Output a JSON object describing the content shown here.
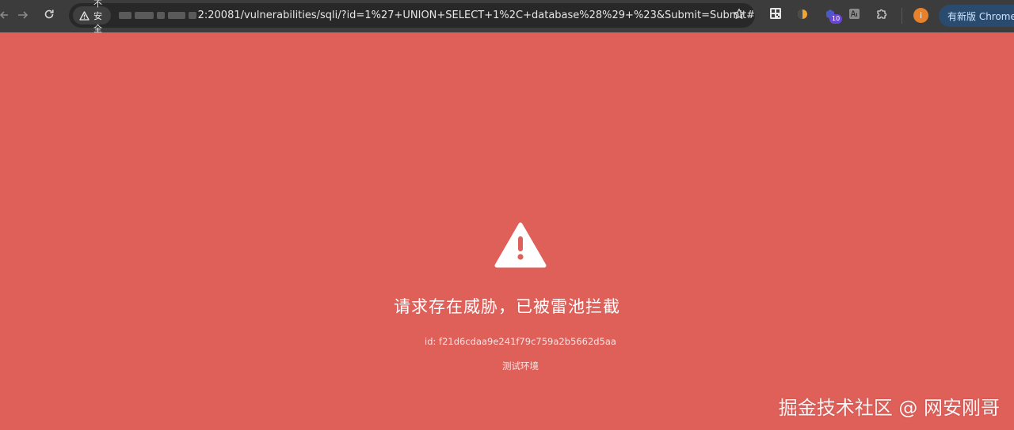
{
  "browser": {
    "back_icon": "arrow-left-icon",
    "forward_icon": "arrow-right-icon",
    "reload_icon": "reload-icon",
    "security_label": "不安全",
    "url_visible": "2:20081/vulnerabilities/sqli/?id=1%27+UNION+SELECT+1%2C+database%28%29+%23&Submit=Submit#",
    "bookmark_icon": "star-icon",
    "extensions": [
      {
        "name": "qr-code-icon"
      },
      {
        "name": "half-moon-icon"
      },
      {
        "name": "extension-badge-icon",
        "badge": "10"
      },
      {
        "name": "ai-icon"
      },
      {
        "name": "puzzle-icon"
      }
    ],
    "profile_initial": "i",
    "new_chrome_label": "有新版 Chrome"
  },
  "block": {
    "icon": "warning-triangle-icon",
    "title": "请求存在威胁，已被雷池拦截",
    "id_text": "id: f21d6cdaa9e241f79c759a2b5662d5aa",
    "env_text": "测试环境"
  },
  "watermark": "掘金技术社区 @ 网安刚哥",
  "colors": {
    "background": "#df5f59",
    "toolbar": "#3c3c3c",
    "omnibox": "#282828"
  }
}
